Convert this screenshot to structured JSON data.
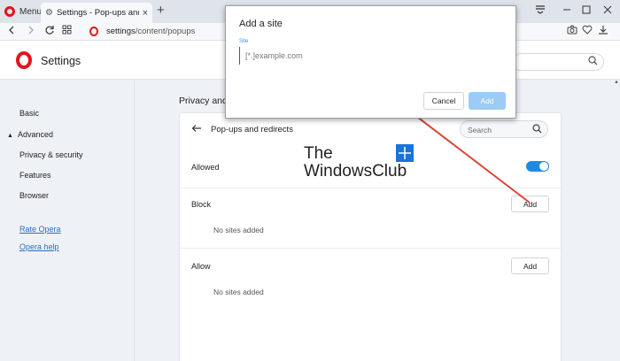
{
  "browser": {
    "menu_label": "Menu",
    "tab_title": "Settings - Pop-ups and redirects",
    "tab_close": "×",
    "new_tab": "+",
    "url_host": "settings",
    "url_path": "/content/popups"
  },
  "settings_header": {
    "title": "Settings"
  },
  "sidebar": {
    "basic": "Basic",
    "advanced": "Advanced",
    "items": [
      "Privacy & security",
      "Features",
      "Browser"
    ],
    "rate_opera": "Rate Opera",
    "opera_help": "Opera help"
  },
  "main": {
    "section_heading": "Privacy and",
    "card_title": "Pop-ups and redirects",
    "search_placeholder": "Search",
    "allowed_label": "Allowed",
    "allowed_on": true,
    "block_label": "Block",
    "block_add": "Add",
    "block_empty": "No sites added",
    "allow_label": "Allow",
    "allow_add": "Add",
    "allow_empty": "No sites added"
  },
  "watermark": {
    "line1": "The",
    "line2": "WindowsClub"
  },
  "dialog": {
    "title": "Add a site",
    "field_label": "Site",
    "placeholder": "[*.]example.com",
    "cancel": "Cancel",
    "add": "Add"
  },
  "colors": {
    "opera_red": "#e0161c",
    "accent_blue": "#1e88e5",
    "disabled_blue": "#9ccbf5",
    "arrow_red": "#d9453b"
  }
}
